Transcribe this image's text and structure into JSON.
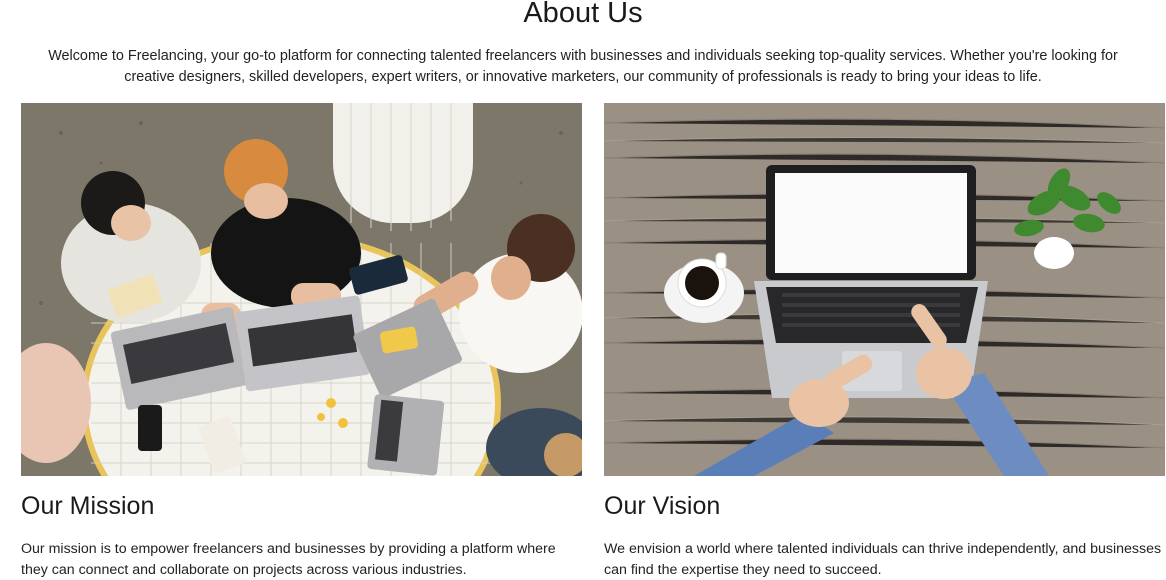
{
  "about": {
    "title": "About Us",
    "intro": "Welcome to Freelancing, your go-to platform for connecting talented freelancers with businesses and individuals seeking top-quality services. Whether you're looking for creative designers, skilled developers, expert writers, or innovative marketers, our community of professionals is ready to bring your ideas to life."
  },
  "mission": {
    "title": "Our Mission",
    "text": "Our mission is to empower freelancers and businesses by providing a platform where they can connect and collaborate on projects across various industries.",
    "image_icon": "team-collaboration-photo"
  },
  "vision": {
    "title": "Our Vision",
    "text": "We envision a world where talented individuals can thrive independently, and businesses can find the expertise they need to succeed.",
    "image_icon": "laptop-workspace-photo"
  },
  "colors": {
    "heading": "#1a1a1a",
    "body_text": "#222222",
    "background": "#ffffff"
  }
}
